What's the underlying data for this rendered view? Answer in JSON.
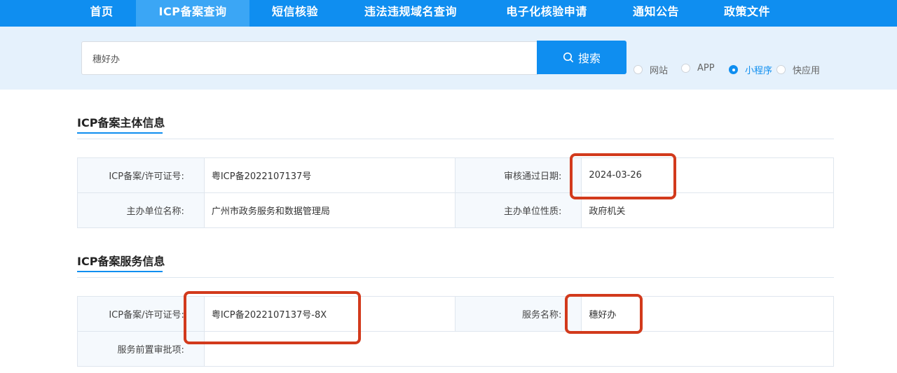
{
  "nav": {
    "items": [
      {
        "label": "首页"
      },
      {
        "label": "ICP备案查询"
      },
      {
        "label": "短信核验"
      },
      {
        "label": "违法违规域名查询"
      },
      {
        "label": "电子化核验申请"
      },
      {
        "label": "通知公告"
      },
      {
        "label": "政策文件"
      }
    ],
    "active": "ICP备案查询"
  },
  "search": {
    "value": "穗好办",
    "button_label": "搜索",
    "options": [
      {
        "label": "网站",
        "checked": false
      },
      {
        "label": "APP",
        "checked": false
      },
      {
        "label": "小程序",
        "checked": true
      },
      {
        "label": "快应用",
        "checked": false
      }
    ]
  },
  "subject_info": {
    "title": "ICP备案主体信息",
    "rows": [
      {
        "label1": "ICP备案/许可证号:",
        "value1": "粤ICP备2022107137号",
        "label2": "审核通过日期:",
        "value2": "2024-03-26"
      },
      {
        "label1": "主办单位名称:",
        "value1": "广州市政务服务和数据管理局",
        "label2": "主办单位性质:",
        "value2": "政府机关"
      }
    ]
  },
  "service_info": {
    "title": "ICP备案服务信息",
    "rows": [
      {
        "label1": "ICP备案/许可证号:",
        "value1": "粤ICP备2022107137号-8X",
        "label2": "服务名称:",
        "value2": "穗好办"
      },
      {
        "label1": "服务前置审批项:",
        "value1": ""
      }
    ]
  },
  "colors": {
    "primary": "#0f8ef0",
    "highlight": "#d23a1c",
    "band": "#e5f1fc"
  }
}
